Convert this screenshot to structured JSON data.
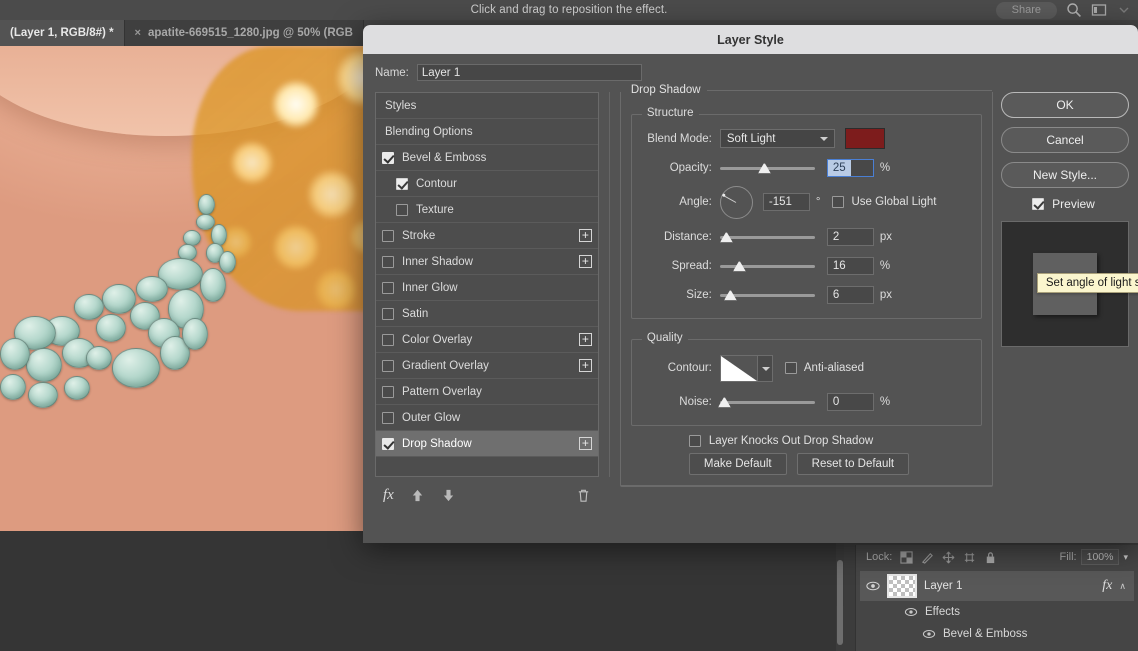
{
  "app": {
    "status_hint": "Click and drag to reposition the effect.",
    "share_label": "Share",
    "icons": {
      "search": "search-icon",
      "workspace": "workspace-icon",
      "chevron": "chevron-down-icon"
    }
  },
  "tabs": [
    {
      "label": "(Layer 1, RGB/8#) *",
      "active": true,
      "close": ""
    },
    {
      "label": "apatite-669515_1280.jpg @ 50% (RGB",
      "active": false,
      "close": "×"
    }
  ],
  "dialog": {
    "title": "Layer Style",
    "name_label": "Name:",
    "name_value": "Layer 1",
    "styles": [
      {
        "label": "Styles",
        "type": "plain"
      },
      {
        "label": "Blending Options",
        "type": "plain"
      },
      {
        "label": "Bevel & Emboss",
        "type": "check",
        "checked": true
      },
      {
        "label": "Contour",
        "type": "check-sub",
        "checked": true,
        "indent": 1
      },
      {
        "label": "Texture",
        "type": "check-sub",
        "checked": false,
        "indent": 1
      },
      {
        "label": "Stroke",
        "type": "check",
        "checked": false,
        "plus": true
      },
      {
        "label": "Inner Shadow",
        "type": "check",
        "checked": false,
        "plus": true
      },
      {
        "label": "Inner Glow",
        "type": "check",
        "checked": false
      },
      {
        "label": "Satin",
        "type": "check",
        "checked": false
      },
      {
        "label": "Color Overlay",
        "type": "check",
        "checked": false,
        "plus": true
      },
      {
        "label": "Gradient Overlay",
        "type": "check",
        "checked": false,
        "plus": true
      },
      {
        "label": "Pattern Overlay",
        "type": "check",
        "checked": false
      },
      {
        "label": "Outer Glow",
        "type": "check",
        "checked": false
      },
      {
        "label": "Drop Shadow",
        "type": "check",
        "checked": true,
        "plus": true,
        "selected": true
      }
    ],
    "styles_toolbar": {
      "fx_label": "fx",
      "icons": [
        "fx-icon",
        "move-up-icon",
        "move-down-icon",
        "trash-icon"
      ]
    },
    "panel": {
      "effect_title": "Drop Shadow",
      "structure": {
        "legend": "Structure",
        "blend_mode_label": "Blend Mode:",
        "blend_mode_value": "Soft Light",
        "color_swatch": "#7d1c1c",
        "opacity_label": "Opacity:",
        "opacity_value": "25",
        "opacity_unit": "%",
        "angle_label": "Angle:",
        "angle_value": "-151",
        "angle_unit": "°",
        "use_global_light_label": "Use Global Light",
        "use_global_light_checked": false,
        "distance_label": "Distance:",
        "distance_value": "2",
        "distance_unit": "px",
        "spread_label": "Spread:",
        "spread_value": "16",
        "spread_unit": "%",
        "size_label": "Size:",
        "size_value": "6",
        "size_unit": "px"
      },
      "quality": {
        "legend": "Quality",
        "contour_label": "Contour:",
        "anti_aliased_label": "Anti-aliased",
        "anti_aliased_checked": false,
        "noise_label": "Noise:",
        "noise_value": "0",
        "noise_unit": "%"
      },
      "knockout_label": "Layer Knocks Out Drop Shadow",
      "knockout_checked": false,
      "make_default_label": "Make Default",
      "reset_default_label": "Reset to Default"
    },
    "tooltip": "Set angle of light source",
    "buttons": {
      "ok": "OK",
      "cancel": "Cancel",
      "new_style": "New Style...",
      "preview_label": "Preview",
      "preview_checked": true
    }
  },
  "layers_panel": {
    "lock_label": "Lock:",
    "lock_icons": [
      "transparency-lock-icon",
      "brush-lock-icon",
      "move-lock-icon",
      "artboard-lock-icon",
      "lock-all-icon"
    ],
    "fill_label": "Fill:",
    "fill_value": "100%",
    "layer": {
      "name": "Layer 1",
      "fx_glyph": "fx",
      "chevron": "∧"
    },
    "effects_label": "Effects",
    "effect_items": [
      "Bevel & Emboss"
    ]
  }
}
